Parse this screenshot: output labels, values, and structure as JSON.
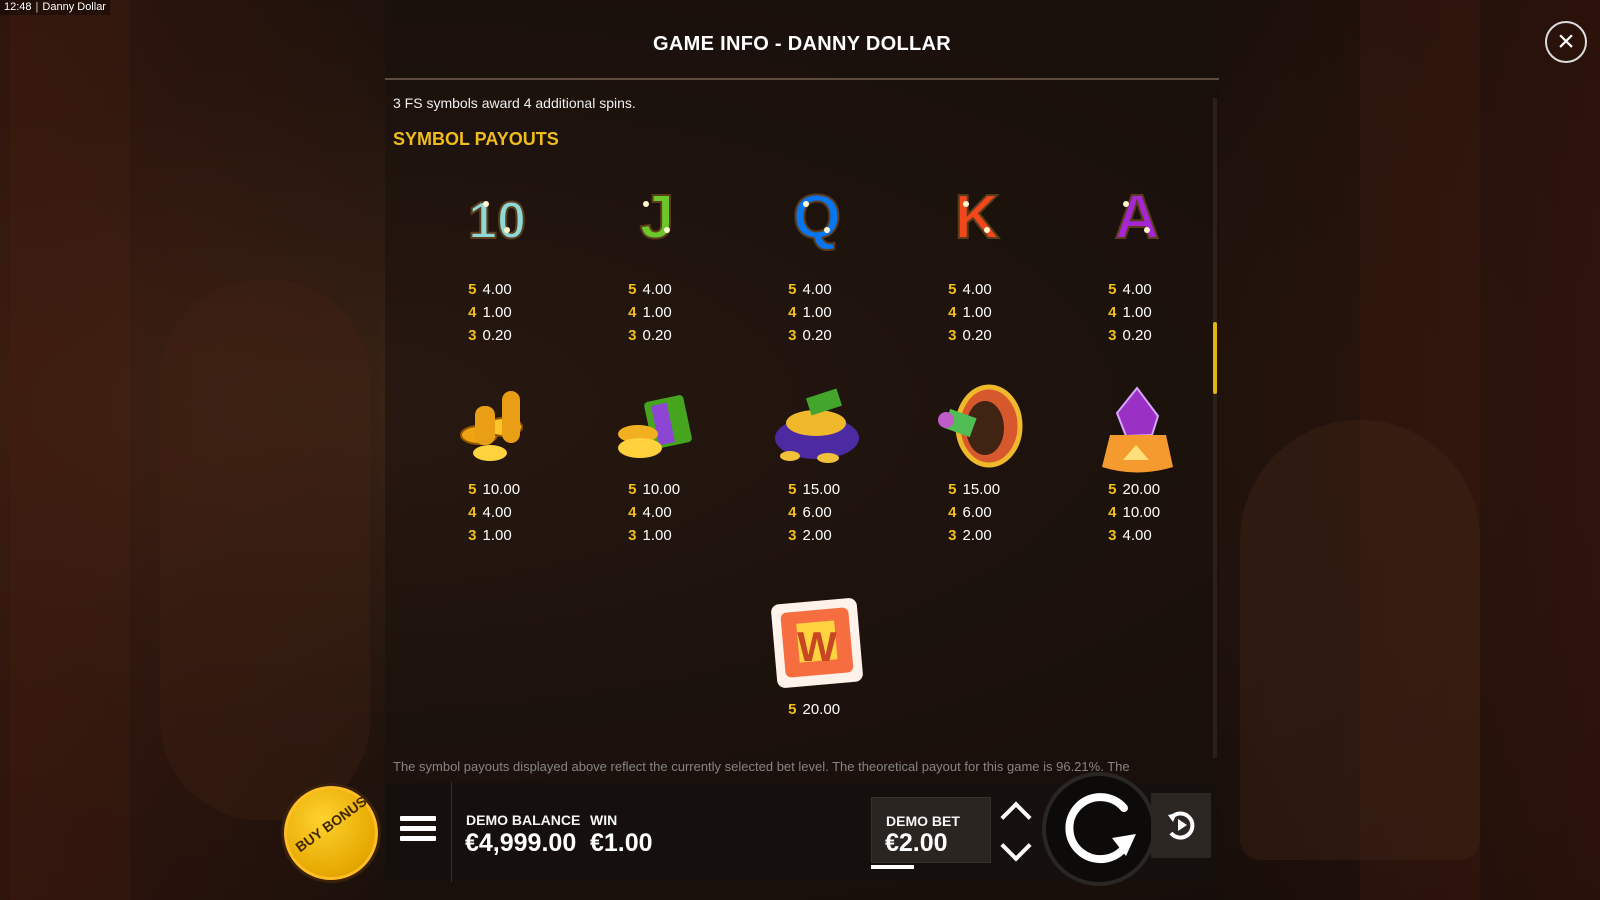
{
  "status": {
    "time": "12:48",
    "app": "Danny Dollar"
  },
  "dialog": {
    "title": "GAME INFO - DANNY DOLLAR",
    "intro": "3 FS symbols award 4 additional spins.",
    "section_title": "SYMBOL PAYOUTS",
    "symbols": [
      {
        "name": "ten",
        "icon": "card-ten-icon",
        "glyph": "10",
        "color": "#8ed9d7",
        "pays": [
          [
            "5",
            "4.00"
          ],
          [
            "4",
            "1.00"
          ],
          [
            "3",
            "0.20"
          ]
        ]
      },
      {
        "name": "jack",
        "icon": "card-jack-icon",
        "glyph": "J",
        "color": "#6cc72b",
        "pays": [
          [
            "5",
            "4.00"
          ],
          [
            "4",
            "1.00"
          ],
          [
            "3",
            "0.20"
          ]
        ]
      },
      {
        "name": "queen",
        "icon": "card-queen-icon",
        "glyph": "Q",
        "color": "#0876ee",
        "pays": [
          [
            "5",
            "4.00"
          ],
          [
            "4",
            "1.00"
          ],
          [
            "3",
            "0.20"
          ]
        ]
      },
      {
        "name": "king",
        "icon": "card-king-icon",
        "glyph": "K",
        "color": "#f2461b",
        "pays": [
          [
            "5",
            "4.00"
          ],
          [
            "4",
            "1.00"
          ],
          [
            "3",
            "0.20"
          ]
        ]
      },
      {
        "name": "ace",
        "icon": "card-ace-icon",
        "glyph": "A",
        "color": "#a526d2",
        "pays": [
          [
            "5",
            "4.00"
          ],
          [
            "4",
            "1.00"
          ],
          [
            "3",
            "0.20"
          ]
        ]
      },
      {
        "name": "coins",
        "icon": "coin-stacks-icon",
        "glyph": "",
        "color": "#eea312",
        "pays": [
          [
            "5",
            "10.00"
          ],
          [
            "4",
            "4.00"
          ],
          [
            "3",
            "1.00"
          ]
        ]
      },
      {
        "name": "cash",
        "icon": "cash-stack-icon",
        "glyph": "",
        "color": "#45a51f",
        "pays": [
          [
            "5",
            "10.00"
          ],
          [
            "4",
            "4.00"
          ],
          [
            "3",
            "1.00"
          ]
        ]
      },
      {
        "name": "hat",
        "icon": "hat-coins-icon",
        "glyph": "",
        "color": "#5a2bb6",
        "pays": [
          [
            "5",
            "15.00"
          ],
          [
            "4",
            "6.00"
          ],
          [
            "3",
            "2.00"
          ]
        ]
      },
      {
        "name": "drum",
        "icon": "drum-icon",
        "glyph": "",
        "color": "#d45822",
        "pays": [
          [
            "5",
            "15.00"
          ],
          [
            "4",
            "6.00"
          ],
          [
            "3",
            "2.00"
          ]
        ]
      },
      {
        "name": "gem",
        "icon": "purple-gem-icon",
        "glyph": "",
        "color": "#9b31c4",
        "pays": [
          [
            "5",
            "20.00"
          ],
          [
            "4",
            "10.00"
          ],
          [
            "3",
            "4.00"
          ]
        ]
      },
      {
        "name": "wild",
        "icon": "wild-badge-icon",
        "glyph": "W",
        "color": "#f6b92a",
        "pays": [
          [
            "5",
            "20.00"
          ]
        ]
      }
    ],
    "footer_note": "The symbol payouts displayed above reflect the currently selected bet level. The theoretical payout for this game is 96.21%. The"
  },
  "controls": {
    "buy_bonus": "BUY BONUS",
    "balance_label": "DEMO BALANCE",
    "balance_value": "€4,999.00",
    "win_label": "WIN",
    "win_value": "€1.00",
    "bet_label": "DEMO BET",
    "bet_value": "€2.00"
  },
  "colors": {
    "gold": "#f2be18",
    "panel": "#15100d",
    "background": "#21140d"
  }
}
